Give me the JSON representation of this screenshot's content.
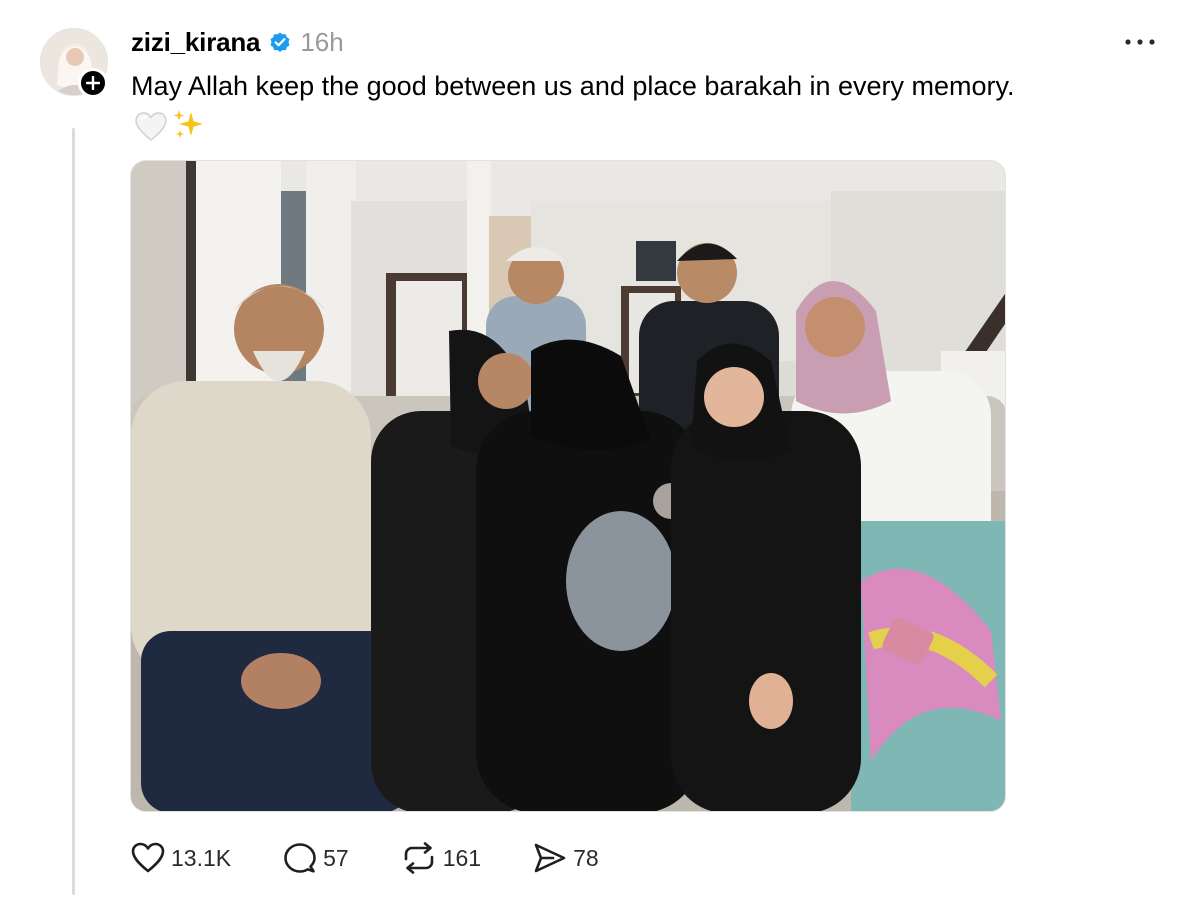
{
  "post": {
    "username": "zizi_kirana",
    "timestamp": "16h",
    "caption": "May Allah keep the good between us and place barakah in every memory.",
    "caption_emojis": [
      "white-heart",
      "sparkles"
    ],
    "verified": true,
    "photo_alt": "Family group photo in a living room"
  },
  "icons": {
    "avatar": "avatar-image",
    "follow": "plus-icon",
    "verified": "verified-badge-icon",
    "more": "more-icon",
    "like": "heart-icon",
    "comment": "comment-icon",
    "repost": "repost-icon",
    "share": "send-icon"
  },
  "actions": {
    "likes": "13.1K",
    "comments": "57",
    "reposts": "161",
    "shares": "78"
  },
  "colors": {
    "verified": "#1d9bf0",
    "secondary_text": "#9a9a9a",
    "thread_line": "#dcdcdc"
  }
}
